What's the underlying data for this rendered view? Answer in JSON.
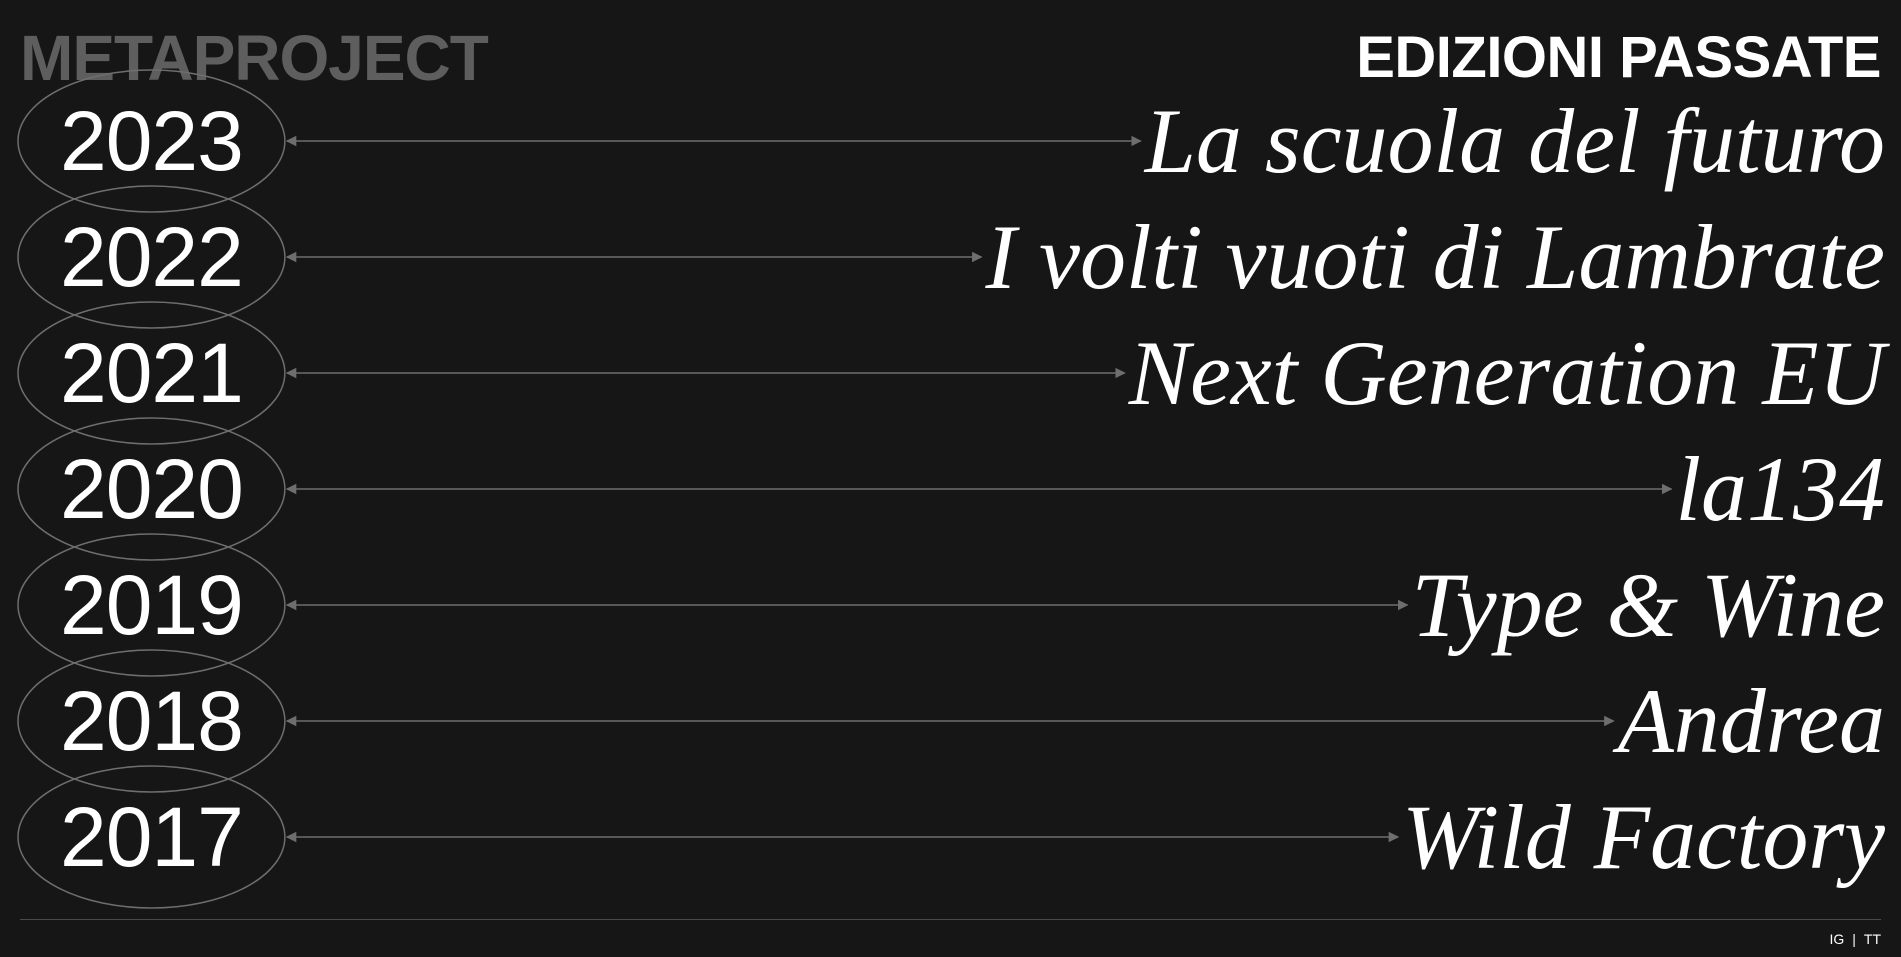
{
  "header": {
    "brand": "METAPROJECT",
    "title": "EDIZIONI PASSATE"
  },
  "editions": [
    {
      "year": "2023",
      "title": "La scuola del futuro"
    },
    {
      "year": "2022",
      "title": "I volti vuoti di Lambrate"
    },
    {
      "year": "2021",
      "title": "Next Generation EU"
    },
    {
      "year": "2020",
      "title": "la134"
    },
    {
      "year": "2019",
      "title": "Type & Wine"
    },
    {
      "year": "2018",
      "title": "Andrea"
    },
    {
      "year": "2017",
      "title": "Wild Factory"
    }
  ],
  "footer": {
    "instagram": "IG",
    "separator": "|",
    "tiktok": "TT"
  },
  "colors": {
    "background": "#161616",
    "text": "#ffffff",
    "muted": "#5e5e5e",
    "line": "#6e6e6e"
  }
}
